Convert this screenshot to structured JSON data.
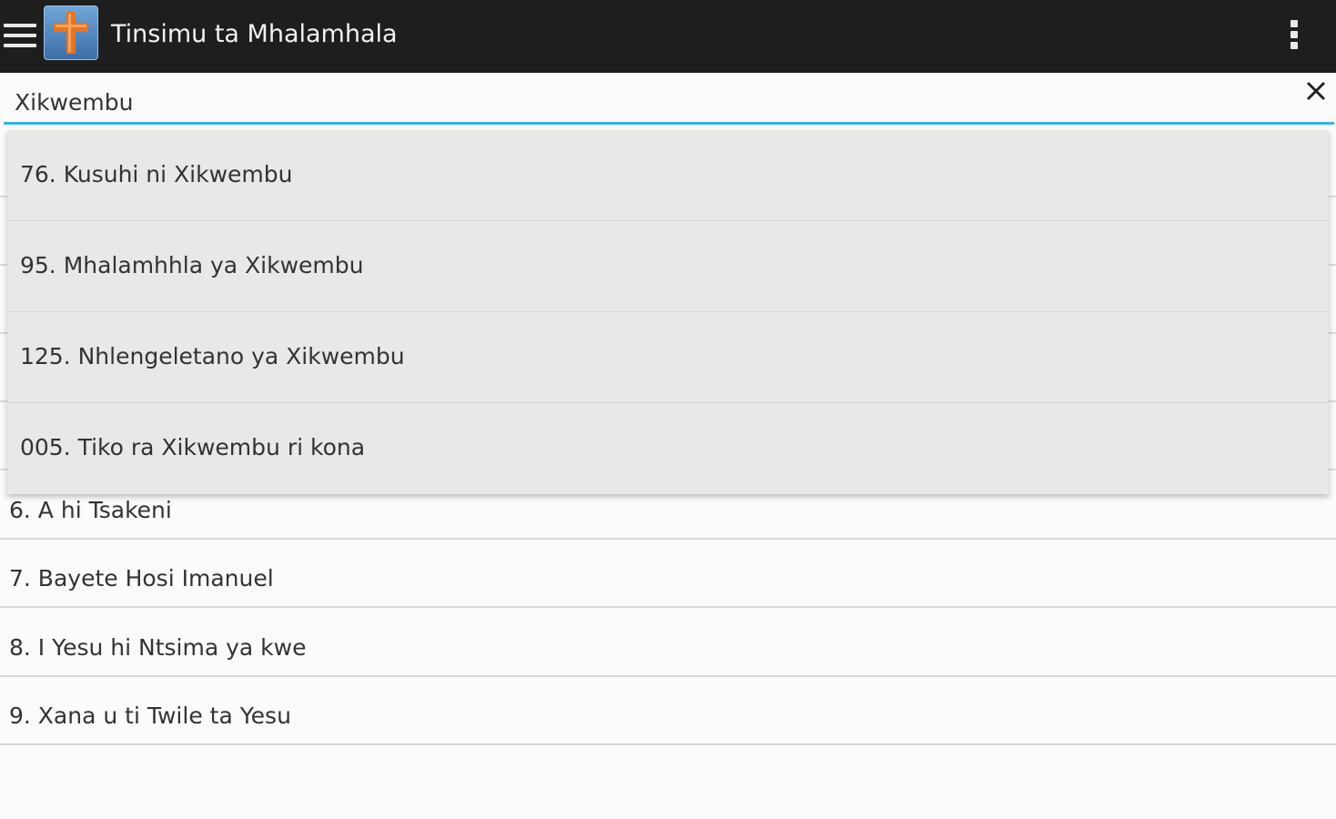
{
  "action_bar": {
    "title": "Tinsimu ta Mhalamhala",
    "menu_icon": "hamburger-menu-icon",
    "app_icon": "cross-icon",
    "overflow_icon": "overflow-menu-icon",
    "background": "#1e1e1e"
  },
  "search": {
    "value": "Xikwembu",
    "clear_icon": "close-icon",
    "accent": "#33b5e5"
  },
  "suggestions": [
    {
      "label": "76. Kusuhi ni Xikwembu"
    },
    {
      "label": "95. Mhalamhhla ya Xikwembu"
    },
    {
      "label": "125. Nhlengeletano ya Xikwembu"
    },
    {
      "label": "005. Tiko ra Xikwembu ri kona"
    }
  ],
  "hymn_list": [
    {
      "label": "6. A hi Tsakeni"
    },
    {
      "label": "7. Bayete Hosi Imanuel"
    },
    {
      "label": "8. I Yesu hi Ntsima ya kwe"
    },
    {
      "label": "9. Xana u ti Twile ta Yesu"
    }
  ]
}
